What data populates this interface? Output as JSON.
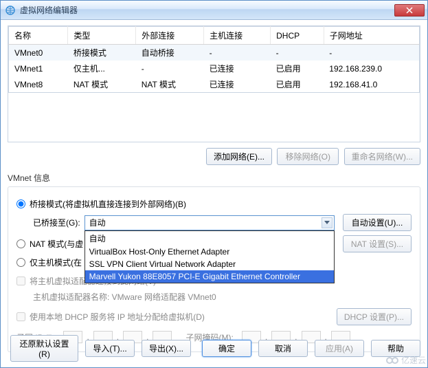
{
  "window": {
    "title": "虚拟网络编辑器"
  },
  "table": {
    "headers": {
      "name": "名称",
      "type": "类型",
      "ext": "外部连接",
      "host": "主机连接",
      "dhcp": "DHCP",
      "subnet": "子网地址"
    },
    "rows": [
      {
        "name": "VMnet0",
        "type": "桥接模式",
        "ext": "自动桥接",
        "host": "-",
        "dhcp": "-",
        "subnet": "-"
      },
      {
        "name": "VMnet1",
        "type": "仅主机...",
        "ext": "-",
        "host": "已连接",
        "dhcp": "已启用",
        "subnet": "192.168.239.0"
      },
      {
        "name": "VMnet8",
        "type": "NAT 模式",
        "ext": "NAT 模式",
        "host": "已连接",
        "dhcp": "已启用",
        "subnet": "192.168.41.0"
      }
    ]
  },
  "buttons": {
    "add_net": "添加网络(E)...",
    "remove_net": "移除网络(O)",
    "rename_net": "重命名网络(W)...",
    "auto_set": "自动设置(U)...",
    "nat_set": "NAT 设置(S)...",
    "dhcp_set": "DHCP 设置(P)...",
    "restore": "还原默认设置(R)",
    "import": "导入(T)...",
    "export": "导出(X)...",
    "ok": "确定",
    "cancel": "取消",
    "apply": "应用(A)",
    "help": "帮助"
  },
  "section": {
    "info_label": "VMnet 信息"
  },
  "radios": {
    "bridge": "桥接模式(将虚拟机直接连接到外部网络)(B)",
    "bridge_to": "已桥接至(G):",
    "nat": "NAT 模式(与虚",
    "hostonly": "仅主机模式(在"
  },
  "combo": {
    "value": "自动",
    "options": [
      {
        "label": "自动",
        "hl": false
      },
      {
        "label": "VirtualBox Host-Only Ethernet Adapter",
        "hl": false
      },
      {
        "label": "SSL VPN Client Virtual Network Adapter",
        "hl": false
      },
      {
        "label": "Marvell Yukon 88E8057 PCI-E Gigabit Ethernet Controller",
        "hl": true
      }
    ]
  },
  "checks": {
    "connect_host": "将主机虚拟适配器连接到此网络(V)",
    "adapter_name_label": "主机虚拟适配器名称: VMware 网络适配器 VMnet0",
    "use_dhcp": "使用本地 DHCP 服务将 IP 地址分配给虚拟机(D)"
  },
  "ip": {
    "subnet_label": "子网 IP (I):",
    "mask_label": "子网掩码(M):"
  },
  "watermark": {
    "text": "亿速云"
  }
}
